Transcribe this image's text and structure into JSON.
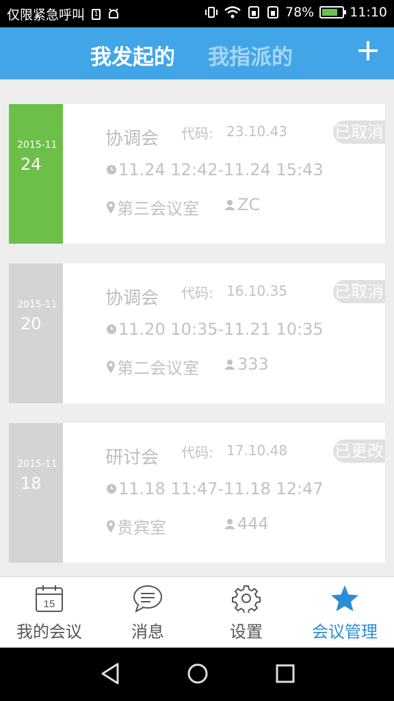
{
  "status_bar": {
    "carrier": "仅限紧急呼叫",
    "sim_label": "1",
    "battery_percent": "78%",
    "battery_level": 0.78,
    "time": "11:10"
  },
  "header": {
    "tabs": [
      {
        "label": "我发起的",
        "active": true
      },
      {
        "label": "我指派的",
        "active": false
      }
    ]
  },
  "meetings": [
    {
      "date_ym": "2015-11",
      "date_day": "24",
      "title": "协调会",
      "code_label": "代码:",
      "code": "23.10.43",
      "status": "已取消",
      "time_range": "11.24 12:42-11.24 15:43",
      "room": "第三会议室",
      "person": "ZC",
      "highlight": true
    },
    {
      "date_ym": "2015-11",
      "date_day": "20",
      "title": "协调会",
      "code_label": "代码:",
      "code": "16.10.35",
      "status": "已取消",
      "time_range": "11.20 10:35-11.21 10:35",
      "room": "第二会议室",
      "person": "333",
      "highlight": false
    },
    {
      "date_ym": "2015-11",
      "date_day": "18",
      "title": "研讨会",
      "code_label": "代码:",
      "code": "17.10.48",
      "status": "已更改",
      "time_range": "11.18 11:47-11.18 12:47",
      "room": "贵宾室",
      "person": "444",
      "highlight": false
    }
  ],
  "bottom_nav": {
    "calendar_day": "15",
    "items": [
      {
        "label": "我的会议",
        "icon": "calendar-icon"
      },
      {
        "label": "消息",
        "icon": "message-icon"
      },
      {
        "label": "设置",
        "icon": "gear-icon"
      },
      {
        "label": "会议管理",
        "icon": "star-icon",
        "active": true
      }
    ]
  },
  "colors": {
    "header": "#42a5e8",
    "date_active": "#6cc04a",
    "date_inactive": "#d4d4d4",
    "nav_active": "#2a8ed6"
  }
}
